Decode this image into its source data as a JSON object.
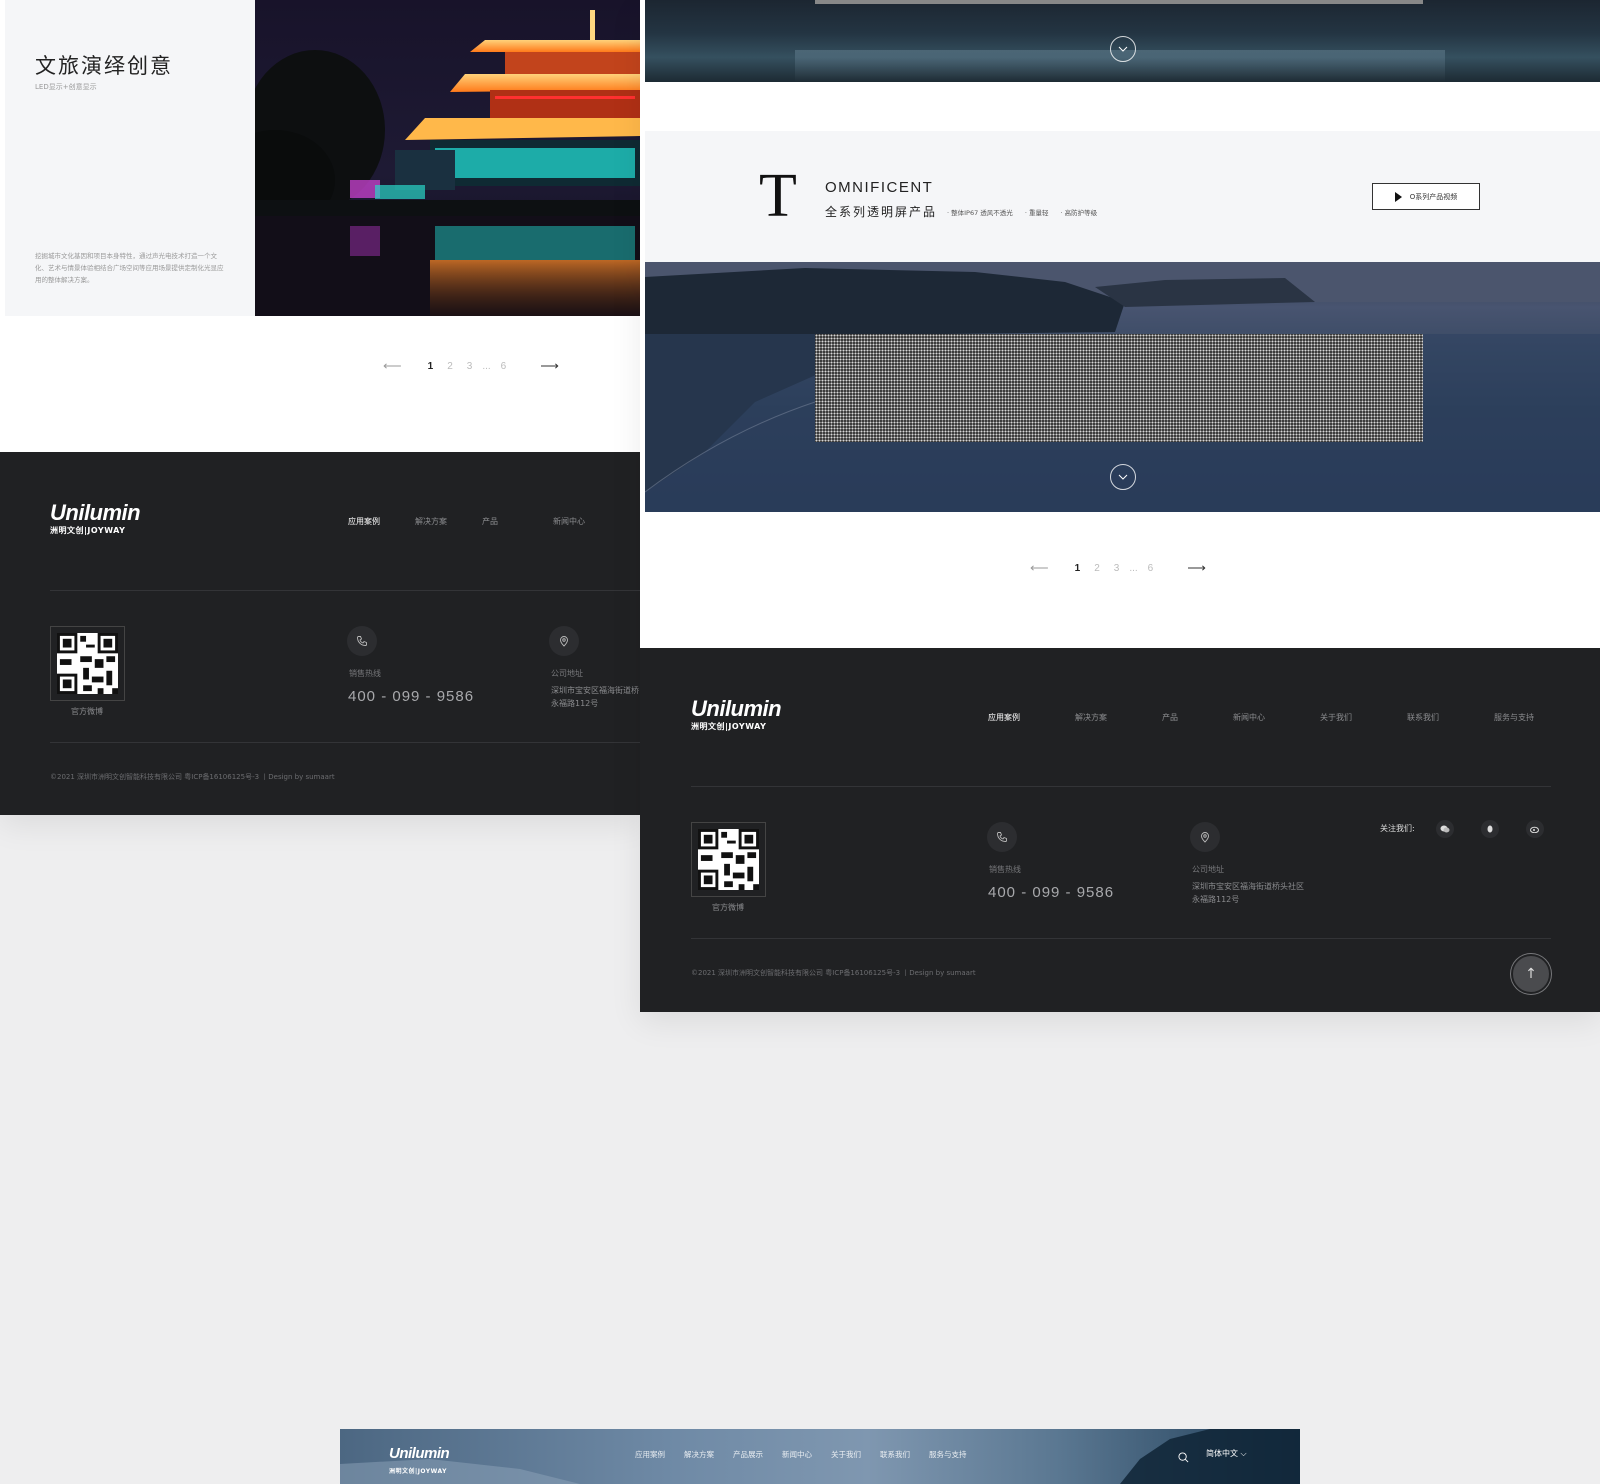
{
  "left_page": {
    "card": {
      "title": "文旅演绎创意",
      "subtitle": "LED显示+创意显示",
      "description": "挖掘城市文化基因和项目本身特性，通过声光电技术打造一个文化、艺术与情景体验相结合广场空间等应用场景提供定制化光显应用的整体解决方案。"
    },
    "pagination": {
      "prev": "⟵",
      "pages": [
        "1",
        "2",
        "3",
        "...",
        "6"
      ],
      "next": "⟶"
    },
    "footer": {
      "logo": {
        "brand": "Unilumin",
        "sub": "洲明文创|JOYWAY"
      },
      "nav": [
        "应用案例",
        "解决方案",
        "产品",
        "新闻中心"
      ],
      "qr_label": "官方微博",
      "hotline_label": "销售热线",
      "phone": "400 - 099 - 9586",
      "address_label": "公司地址",
      "address_line1": "深圳市宝安区福海街道桥",
      "address_line2": "永福路112号",
      "copyright": "©2021 深圳市洲明文创智能科技有限公司 粤ICP备16106125号-3 丨Design by sumaart"
    }
  },
  "right_page": {
    "series": {
      "letter": "T",
      "name_en": "OMNIFICENT",
      "name_cn": "全系列透明屏产品",
      "features": [
        "· 整体IP67 透风不透光",
        "· 重量轻",
        "· 高防护等级"
      ],
      "video_button": "O系列产品视频"
    },
    "pagination": {
      "prev": "⟵",
      "pages": [
        "1",
        "2",
        "3",
        "...",
        "6"
      ],
      "next": "⟶"
    },
    "footer": {
      "logo": {
        "brand": "Unilumin",
        "sub": "洲明文创|JOYWAY"
      },
      "nav": [
        "应用案例",
        "解决方案",
        "产品",
        "新闻中心",
        "关于我们",
        "联系我们",
        "服务与支持"
      ],
      "qr_label": "官方微博",
      "hotline_label": "销售热线",
      "phone": "400 - 099 - 9586",
      "address_label": "公司地址",
      "address_line1": "深圳市宝安区福海街道桥头社区",
      "address_line2": "永福路112号",
      "follow_label": "关注我们:",
      "social_icons": [
        "wechat-icon",
        "qq-icon",
        "weibo-icon"
      ],
      "copyright": "©2021 深圳市洲明文创智能科技有限公司 粤ICP备16106125号-3 丨Design by sumaart",
      "back_to_top": "↑"
    }
  },
  "bottom_header": {
    "logo": {
      "brand": "Unilumin",
      "sub": "洲明文创|JOYWAY"
    },
    "nav": [
      "应用案例",
      "解决方案",
      "产品展示",
      "新闻中心",
      "关于我们",
      "联系我们",
      "服务与支持"
    ],
    "language": "简体中文 ⌵"
  },
  "colors": {
    "footer_bg": "#202123",
    "card_bg": "#f5f6f8",
    "page_bg": "#eeeeef"
  }
}
